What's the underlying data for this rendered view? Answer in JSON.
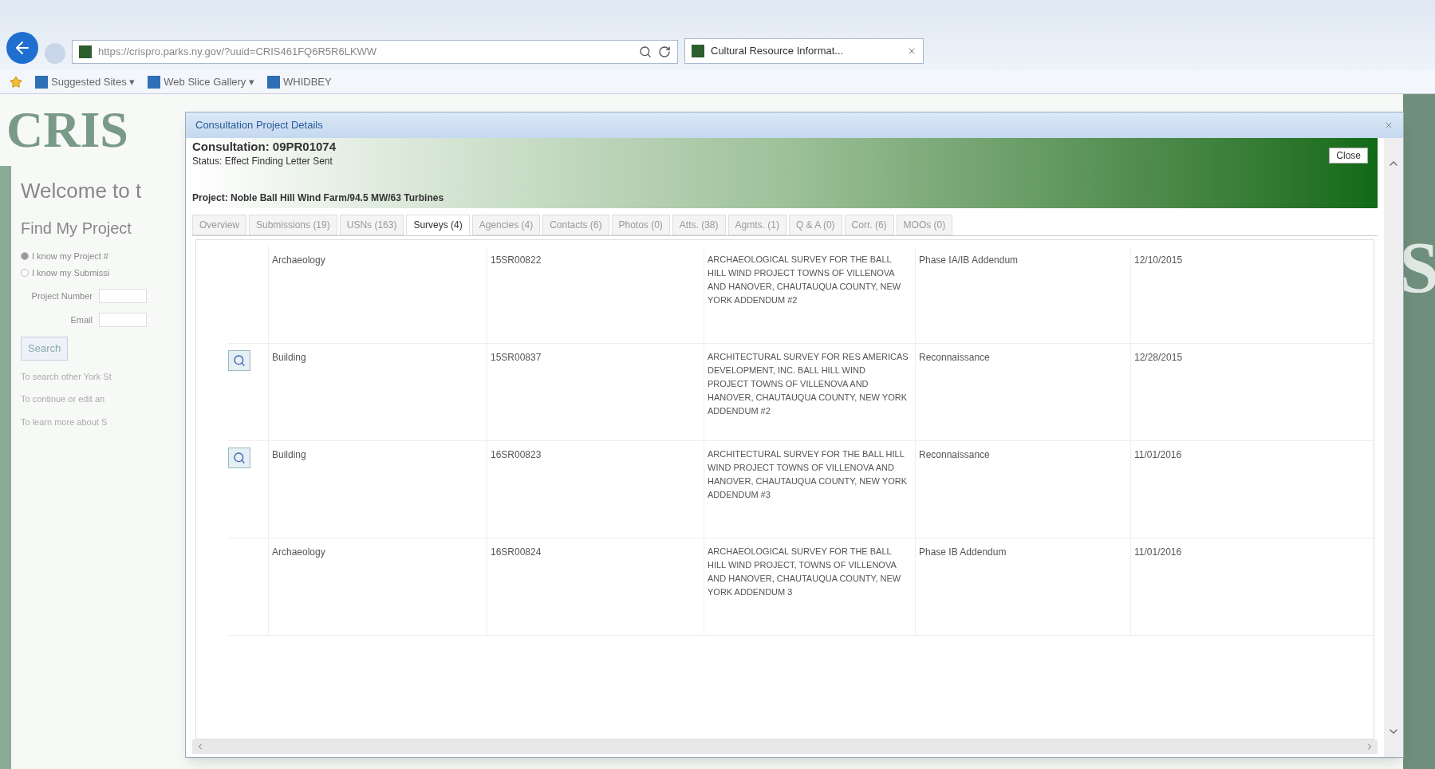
{
  "browser": {
    "url": "https://crispro.parks.ny.gov/?uuid=CRIS461FQ6R5R6LKWW",
    "tab": "Cultural Resource Informat...",
    "favorites": [
      {
        "label": "Suggested Sites ▾"
      },
      {
        "label": "Web Slice Gallery ▾"
      },
      {
        "label": "WHIDBEY"
      }
    ]
  },
  "page": {
    "logo": "CRIS",
    "welcome": "Welcome to t",
    "find_title": "Find My Project",
    "radios": [
      {
        "label": "I know my Project #",
        "selected": true
      },
      {
        "label": "I know my Submissi",
        "selected": false
      }
    ],
    "fields": [
      {
        "label": "Project Number"
      },
      {
        "label": "Email"
      }
    ],
    "search_button": "Search",
    "notes": [
      "To search other York St",
      "To continue or edit an",
      "To learn more about S"
    ],
    "side_letter": "S"
  },
  "dialog": {
    "title": "Consultation Project Details",
    "heading": "Consultation: 09PR01074",
    "status": "Status: Effect Finding Letter Sent",
    "close": "Close",
    "project": "Project: Noble Ball Hill Wind Farm/94.5 MW/63 Turbines",
    "tabs": [
      {
        "label": "Overview",
        "selected": false
      },
      {
        "label": "Submissions (19)",
        "selected": false
      },
      {
        "label": "USNs (163)",
        "selected": false
      },
      {
        "label": "Surveys (4)",
        "selected": true
      },
      {
        "label": "Agencies (4)",
        "selected": false
      },
      {
        "label": "Contacts (6)",
        "selected": false
      },
      {
        "label": "Photos (0)",
        "selected": false
      },
      {
        "label": "Atts. (38)",
        "selected": false
      },
      {
        "label": "Agmts. (1)",
        "selected": false
      },
      {
        "label": "Q & A (0)",
        "selected": false
      },
      {
        "label": "Corr. (6)",
        "selected": false
      },
      {
        "label": "MOOs (0)",
        "selected": false
      }
    ],
    "rows": [
      {
        "view": false,
        "type": "Archaeology",
        "number": "15SR00822",
        "title": "ARCHAEOLOGICAL SURVEY FOR THE BALL HILL WIND PROJECT TOWNS OF VILLENOVA AND HANOVER, CHAUTAUQUA COUNTY, NEW YORK ADDENDUM #2",
        "survey_type": "Phase IA/IB Addendum",
        "date": "12/10/2015"
      },
      {
        "view": true,
        "type": "Building",
        "number": "15SR00837",
        "title": "ARCHITECTURAL SURVEY FOR RES AMERICAS DEVELOPMENT, INC. BALL HILL WIND PROJECT TOWNS OF VILLENOVA AND HANOVER, CHAUTAUQUA COUNTY, NEW YORK ADDENDUM #2",
        "survey_type": "Reconnaissance",
        "date": "12/28/2015"
      },
      {
        "view": true,
        "type": "Building",
        "number": "16SR00823",
        "title": "ARCHITECTURAL SURVEY FOR THE BALL HILL WIND PROJECT TOWNS OF VILLENOVA AND HANOVER, CHAUTAUQUA COUNTY, NEW YORK ADDENDUM #3",
        "survey_type": "Reconnaissance",
        "date": "11/01/2016"
      },
      {
        "view": false,
        "type": "Archaeology",
        "number": "16SR00824",
        "title": "ARCHAEOLOGICAL SURVEY FOR THE BALL HILL WIND PROJECT, TOWNS OF VILLENOVA AND HANOVER, CHAUTAUQUA COUNTY, NEW YORK ADDENDUM 3",
        "survey_type": "Phase IB Addendum",
        "date": "11/01/2016"
      }
    ]
  }
}
